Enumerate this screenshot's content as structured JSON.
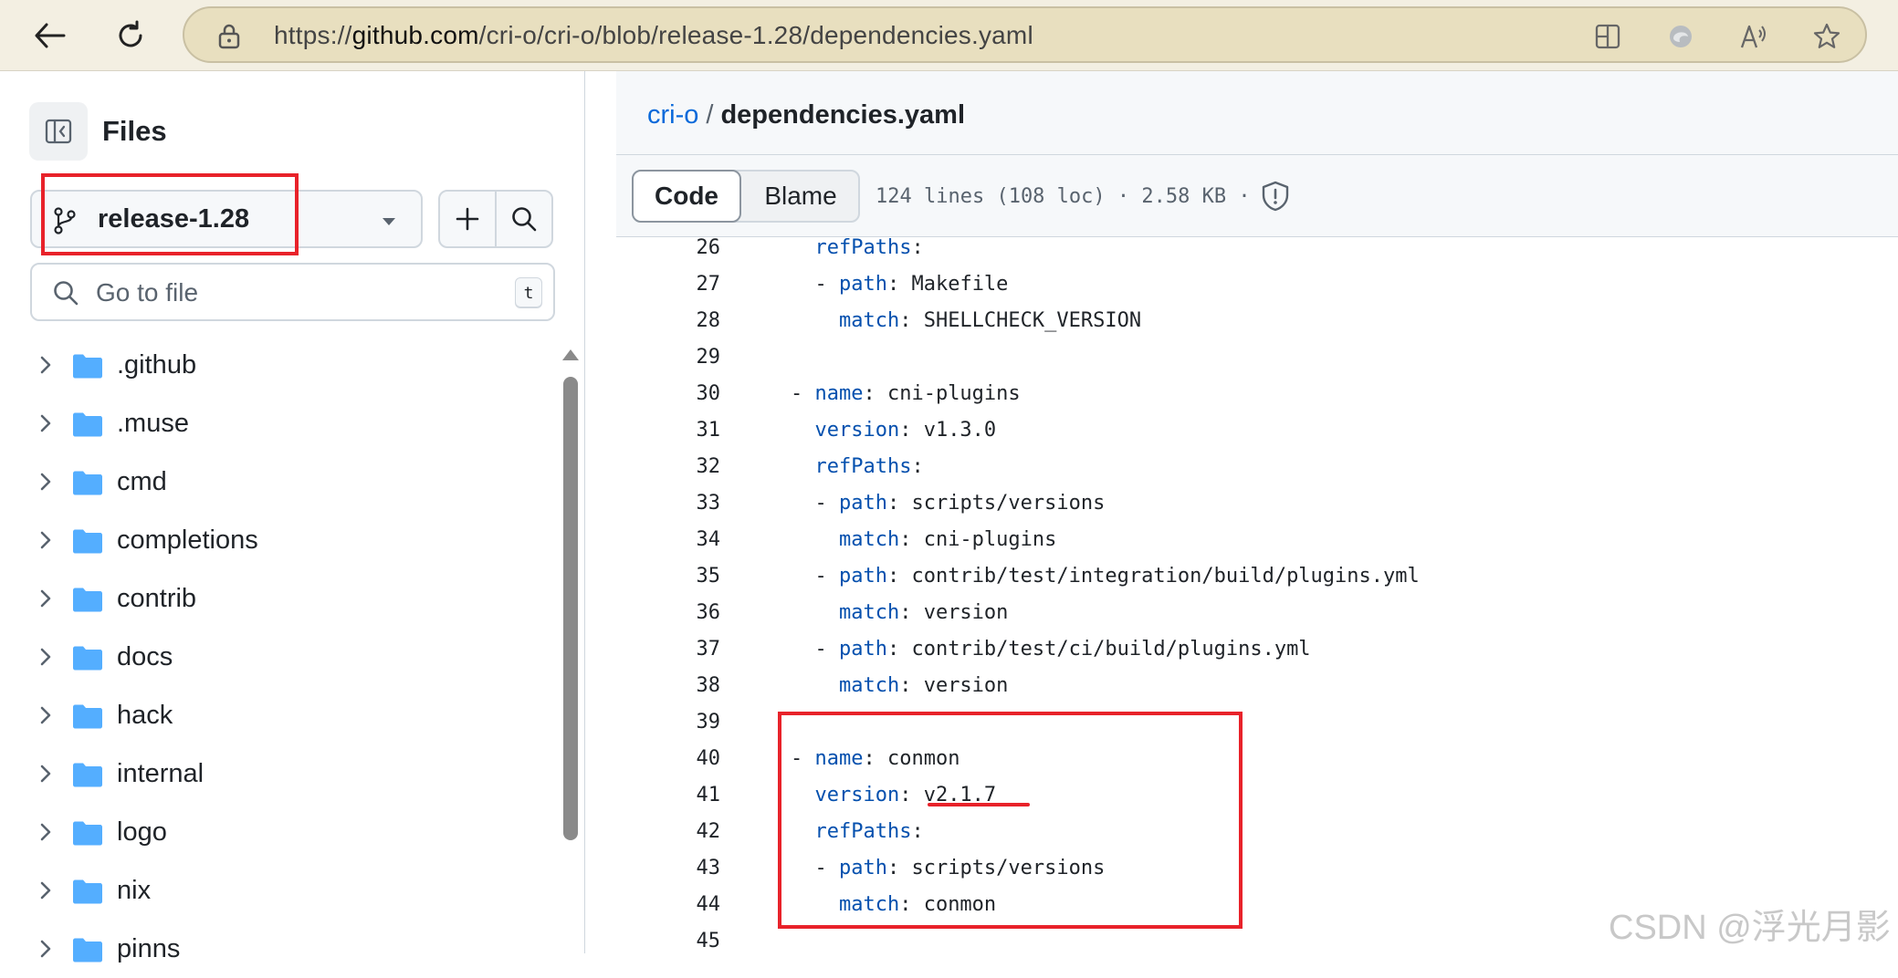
{
  "browser": {
    "url_prefix": "https://",
    "url_host": "github.com",
    "url_path": "/cri-o/cri-o/blob/release-1.28/dependencies.yaml",
    "icons": [
      "back-arrow-icon",
      "refresh-icon",
      "lock-icon",
      "split-screen-icon",
      "edge-icon",
      "read-aloud-icon",
      "favorite-star-icon"
    ]
  },
  "sidebar": {
    "title": "Files",
    "branch": "release-1.28",
    "search_placeholder": "Go to file",
    "search_shortcut": "t",
    "tree": [
      {
        "name": ".github"
      },
      {
        "name": ".muse"
      },
      {
        "name": "cmd"
      },
      {
        "name": "completions"
      },
      {
        "name": "contrib"
      },
      {
        "name": "docs"
      },
      {
        "name": "hack"
      },
      {
        "name": "internal"
      },
      {
        "name": "logo"
      },
      {
        "name": "nix"
      },
      {
        "name": "pinns"
      }
    ]
  },
  "main": {
    "breadcrumb": {
      "repo": "cri-o",
      "separator": "/",
      "file": "dependencies.yaml"
    },
    "tabs": {
      "code": "Code",
      "blame": "Blame"
    },
    "file_info": "124 lines (108 loc) · 2.58 KB ·",
    "lines": [
      {
        "n": "26",
        "indent": "      ",
        "dash": "",
        "key": "refPaths",
        "value": ""
      },
      {
        "n": "27",
        "indent": "      ",
        "dash": "- ",
        "key": "path",
        "value": " Makefile"
      },
      {
        "n": "28",
        "indent": "        ",
        "dash": "",
        "key": "match",
        "value": " SHELLCHECK_VERSION"
      },
      {
        "n": "29",
        "indent": "",
        "dash": "",
        "key": "",
        "value": ""
      },
      {
        "n": "30",
        "indent": "    ",
        "dash": "- ",
        "key": "name",
        "value": " cni-plugins"
      },
      {
        "n": "31",
        "indent": "      ",
        "dash": "",
        "key": "version",
        "value": " v1.3.0"
      },
      {
        "n": "32",
        "indent": "      ",
        "dash": "",
        "key": "refPaths",
        "value": ""
      },
      {
        "n": "33",
        "indent": "      ",
        "dash": "- ",
        "key": "path",
        "value": " scripts/versions"
      },
      {
        "n": "34",
        "indent": "        ",
        "dash": "",
        "key": "match",
        "value": " cni-plugins"
      },
      {
        "n": "35",
        "indent": "      ",
        "dash": "- ",
        "key": "path",
        "value": " contrib/test/integration/build/plugins.yml"
      },
      {
        "n": "36",
        "indent": "        ",
        "dash": "",
        "key": "match",
        "value": " version"
      },
      {
        "n": "37",
        "indent": "      ",
        "dash": "- ",
        "key": "path",
        "value": " contrib/test/ci/build/plugins.yml"
      },
      {
        "n": "38",
        "indent": "        ",
        "dash": "",
        "key": "match",
        "value": " version"
      },
      {
        "n": "39",
        "indent": "",
        "dash": "",
        "key": "",
        "value": ""
      },
      {
        "n": "40",
        "indent": "    ",
        "dash": "- ",
        "key": "name",
        "value": " conmon"
      },
      {
        "n": "41",
        "indent": "      ",
        "dash": "",
        "key": "version",
        "value": " v2.1.7"
      },
      {
        "n": "42",
        "indent": "      ",
        "dash": "",
        "key": "refPaths",
        "value": ""
      },
      {
        "n": "43",
        "indent": "      ",
        "dash": "- ",
        "key": "path",
        "value": " scripts/versions"
      },
      {
        "n": "44",
        "indent": "        ",
        "dash": "",
        "key": "match",
        "value": " conmon"
      },
      {
        "n": "45",
        "indent": "",
        "dash": "",
        "key": "",
        "value": ""
      }
    ]
  },
  "watermark": "CSDN @浮光月影",
  "colors": {
    "annotation_red": "#e8222a",
    "link_blue": "#0969da",
    "yaml_key": "#0550ae",
    "folder_blue": "#54aeff"
  }
}
